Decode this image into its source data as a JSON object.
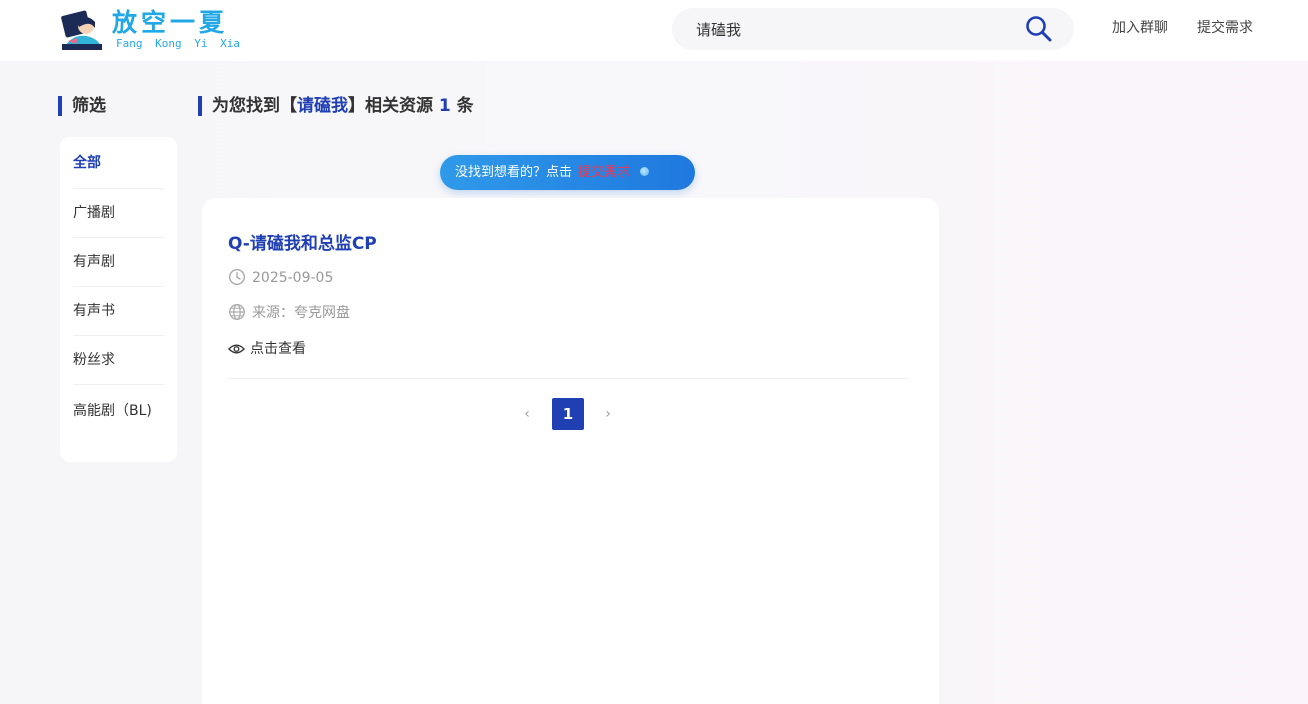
{
  "header": {
    "logo_title": "放空一夏",
    "logo_subtitle": "Fang Kong  Yi  Xia",
    "search_value": "请磕我",
    "nav": {
      "join_group": "加入群聊",
      "submit_request": "提交需求"
    }
  },
  "sidebar": {
    "heading": "筛选",
    "items": [
      {
        "label": "全部",
        "active": true
      },
      {
        "label": "广播剧",
        "active": false
      },
      {
        "label": "有声剧",
        "active": false
      },
      {
        "label": "有声书",
        "active": false
      },
      {
        "label": "粉丝求",
        "active": false
      },
      {
        "label": "高能剧（BL)",
        "active": false
      }
    ]
  },
  "results": {
    "heading_prefix": "为您找到【",
    "keyword": "请磕我",
    "heading_middle": "】相关资源 ",
    "count": "1",
    "heading_suffix": " 条",
    "notice_text": "没找到想看的？点击",
    "notice_link": "提交需求",
    "items": [
      {
        "title": "Q-请磕我和总监CP",
        "date": "2025-09-05",
        "source": "来源：夸克网盘",
        "view_label": "点击查看"
      }
    ],
    "pagination": {
      "prev": "‹",
      "current": "1",
      "next": "›"
    }
  },
  "colors": {
    "accent": "#1f3fb3",
    "logo": "#22a8e6",
    "notice_link": "#e53b5a"
  },
  "icons": {
    "search": "search-icon",
    "clock": "clock-icon",
    "globe": "globe-icon",
    "eye": "eye-icon"
  }
}
